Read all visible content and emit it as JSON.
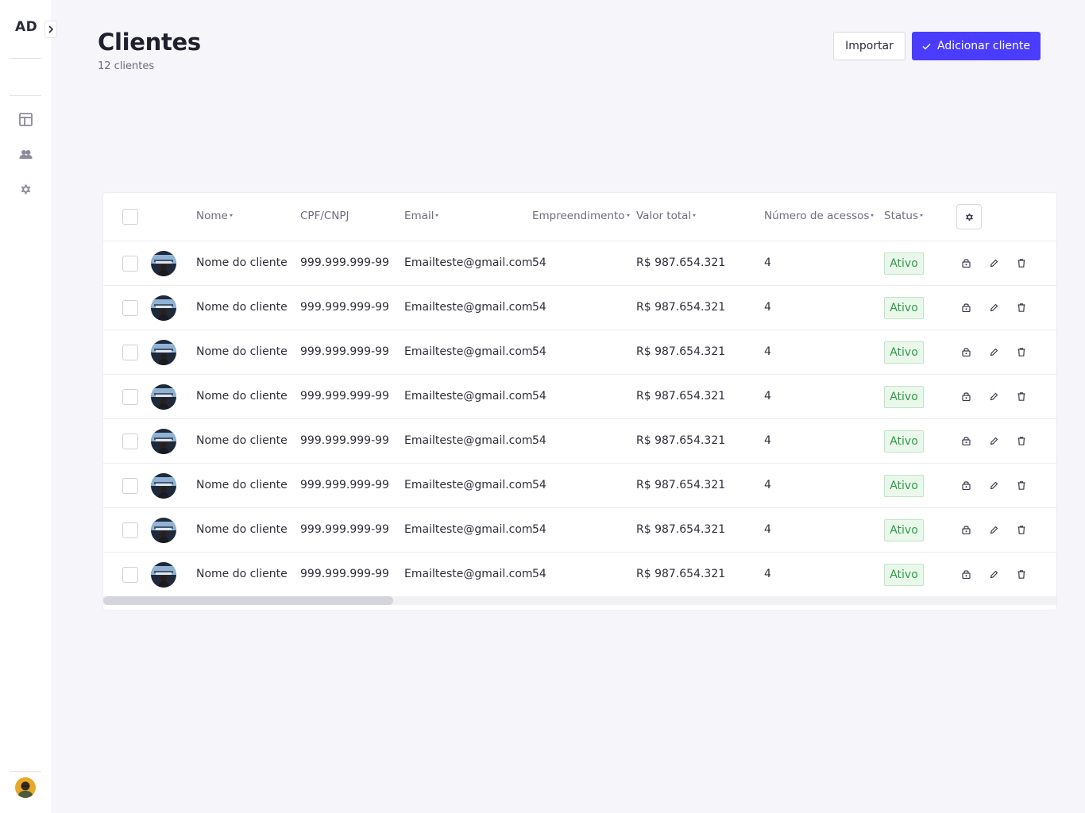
{
  "sidebar": {
    "logo": "AD",
    "nav": [
      {
        "icon": "layout-icon"
      },
      {
        "icon": "users-icon"
      },
      {
        "icon": "gear-icon"
      }
    ]
  },
  "header": {
    "title": "Clientes",
    "subtitle": "12 clientes",
    "import_label": "Importar",
    "add_label": "Adicionar cliente"
  },
  "table": {
    "columns": {
      "nome": "Nome",
      "cpf": "CPF/CNPJ",
      "email": "Email",
      "empreendimento": "Empreendimento",
      "valor": "Valor total",
      "acessos": "Número de acessos",
      "status": "Status"
    },
    "rows": [
      {
        "nome": "Nome do cliente",
        "cpf": "999.999.999-99",
        "email": "Emailteste@gmail.com",
        "empreendimento": "54",
        "valor": "R$ 987.654.321",
        "acessos": "4",
        "status": "Ativo"
      },
      {
        "nome": "Nome do cliente",
        "cpf": "999.999.999-99",
        "email": "Emailteste@gmail.com",
        "empreendimento": "54",
        "valor": "R$ 987.654.321",
        "acessos": "4",
        "status": "Ativo"
      },
      {
        "nome": "Nome do cliente",
        "cpf": "999.999.999-99",
        "email": "Emailteste@gmail.com",
        "empreendimento": "54",
        "valor": "R$ 987.654.321",
        "acessos": "4",
        "status": "Ativo"
      },
      {
        "nome": "Nome do cliente",
        "cpf": "999.999.999-99",
        "email": "Emailteste@gmail.com",
        "empreendimento": "54",
        "valor": "R$ 987.654.321",
        "acessos": "4",
        "status": "Ativo"
      },
      {
        "nome": "Nome do cliente",
        "cpf": "999.999.999-99",
        "email": "Emailteste@gmail.com",
        "empreendimento": "54",
        "valor": "R$ 987.654.321",
        "acessos": "4",
        "status": "Ativo"
      },
      {
        "nome": "Nome do cliente",
        "cpf": "999.999.999-99",
        "email": "Emailteste@gmail.com",
        "empreendimento": "54",
        "valor": "R$ 987.654.321",
        "acessos": "4",
        "status": "Ativo"
      },
      {
        "nome": "Nome do cliente",
        "cpf": "999.999.999-99",
        "email": "Emailteste@gmail.com",
        "empreendimento": "54",
        "valor": "R$ 987.654.321",
        "acessos": "4",
        "status": "Ativo"
      },
      {
        "nome": "Nome do cliente",
        "cpf": "999.999.999-99",
        "email": "Emailteste@gmail.com",
        "empreendimento": "54",
        "valor": "R$ 987.654.321",
        "acessos": "4",
        "status": "Ativo"
      }
    ]
  },
  "colors": {
    "accent": "#4a3dff",
    "status_green": "#2f9b45",
    "background": "#f5f5fa"
  }
}
